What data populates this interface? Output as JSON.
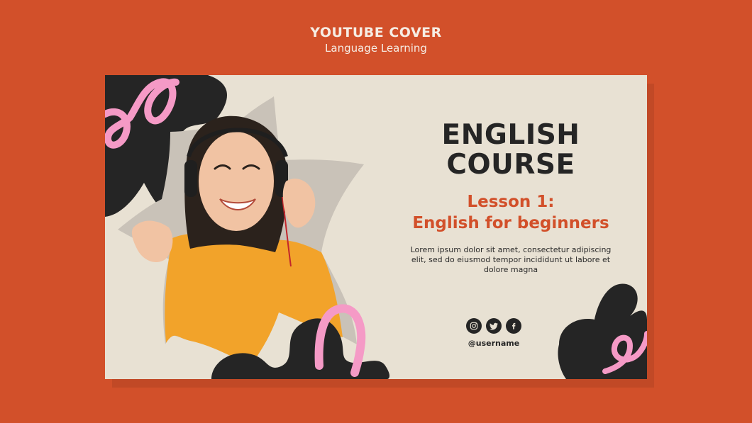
{
  "header": {
    "title": "YOUTUBE COVER",
    "subtitle": "Language Learning"
  },
  "card": {
    "headline_line1": "ENGLISH",
    "headline_line2": "COURSE",
    "lesson_line1": "Lesson 1:",
    "lesson_line2": "English for beginners",
    "description": "Lorem ipsum dolor sit amet, consectetur adipiscing elit, sed do eiusmod tempor incididunt ut labore et dolore magna",
    "socials": {
      "instagram_icon": "instagram-icon",
      "twitter_icon": "twitter-icon",
      "facebook_icon": "facebook-icon"
    },
    "username": "@username"
  },
  "colors": {
    "page_background": "#d2502a",
    "card_background": "#e8e1d3",
    "ink": "#252525",
    "accent_orange": "#d2502a",
    "accent_pink": "#f59ac6",
    "shirt_yellow": "#f2a32a"
  }
}
